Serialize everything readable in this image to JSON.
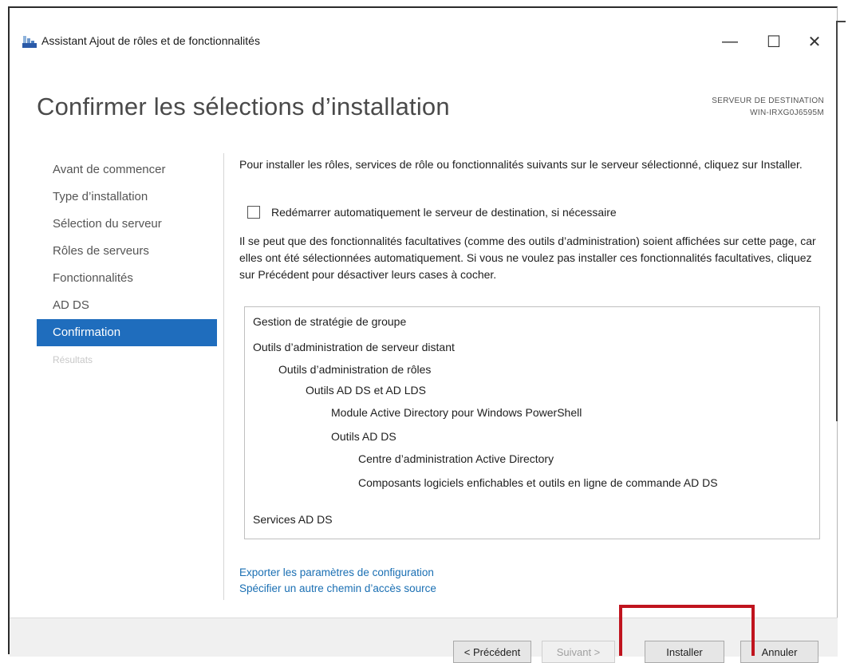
{
  "window": {
    "title": "Assistant Ajout de rôles et de fonctionnalités",
    "minimize_glyph": "—",
    "maximize_glyph": "☐",
    "close_glyph": "✕"
  },
  "header": {
    "title": "Confirmer les sélections d’installation",
    "destination_label": "SERVEUR DE DESTINATION",
    "destination_server": "WIN-IRXG0J6595M"
  },
  "nav": {
    "items": [
      {
        "label": "Avant de commencer",
        "state": "normal"
      },
      {
        "label": "Type d’installation",
        "state": "normal"
      },
      {
        "label": "Sélection du serveur",
        "state": "normal"
      },
      {
        "label": "Rôles de serveurs",
        "state": "normal"
      },
      {
        "label": "Fonctionnalités",
        "state": "normal"
      },
      {
        "label": "AD DS",
        "state": "normal"
      },
      {
        "label": "Confirmation",
        "state": "active"
      },
      {
        "label": "Résultats",
        "state": "disabled"
      }
    ]
  },
  "content": {
    "intro": "Pour installer les rôles, services de rôle ou fonctionnalités suivants sur le serveur sélectionné, cliquez sur Installer.",
    "restart_checkbox_label": "Redémarrer automatiquement le serveur de destination, si nécessaire",
    "restart_checked": false,
    "info": "Il se peut que des fonctionnalités facultatives (comme des outils d’administration) soient affichées sur cette page, car elles ont été sélectionnées automatiquement. Si vous ne voulez pas installer ces fonctionnalités facultatives, cliquez sur Précédent pour désactiver leurs cases à cocher.",
    "features": [
      {
        "label": "Gestion de stratégie de groupe",
        "level": 0
      },
      {
        "label": "Outils d’administration de serveur distant",
        "level": 0
      },
      {
        "label": "Outils d’administration de rôles",
        "level": 1
      },
      {
        "label": "Outils AD DS et AD LDS",
        "level": 2
      },
      {
        "label": "Module Active Directory pour Windows PowerShell",
        "level": 3
      },
      {
        "label": "Outils AD DS",
        "level": 3
      },
      {
        "label": "Centre d’administration Active Directory",
        "level": 4
      },
      {
        "label": "Composants logiciels enfichables et outils en ligne de commande AD DS",
        "level": 4
      },
      {
        "label": "Services AD DS",
        "level": 0
      }
    ],
    "export_link": "Exporter les paramètres de configuration",
    "source_link": "Spécifier un autre chemin d’accès source"
  },
  "footer": {
    "previous": "< Précédent",
    "next": "Suivant >",
    "install": "Installer",
    "cancel": "Annuler"
  },
  "colors": {
    "accent": "#1f6dbd",
    "link": "#1a6fb3",
    "highlight": "#c0141e"
  }
}
